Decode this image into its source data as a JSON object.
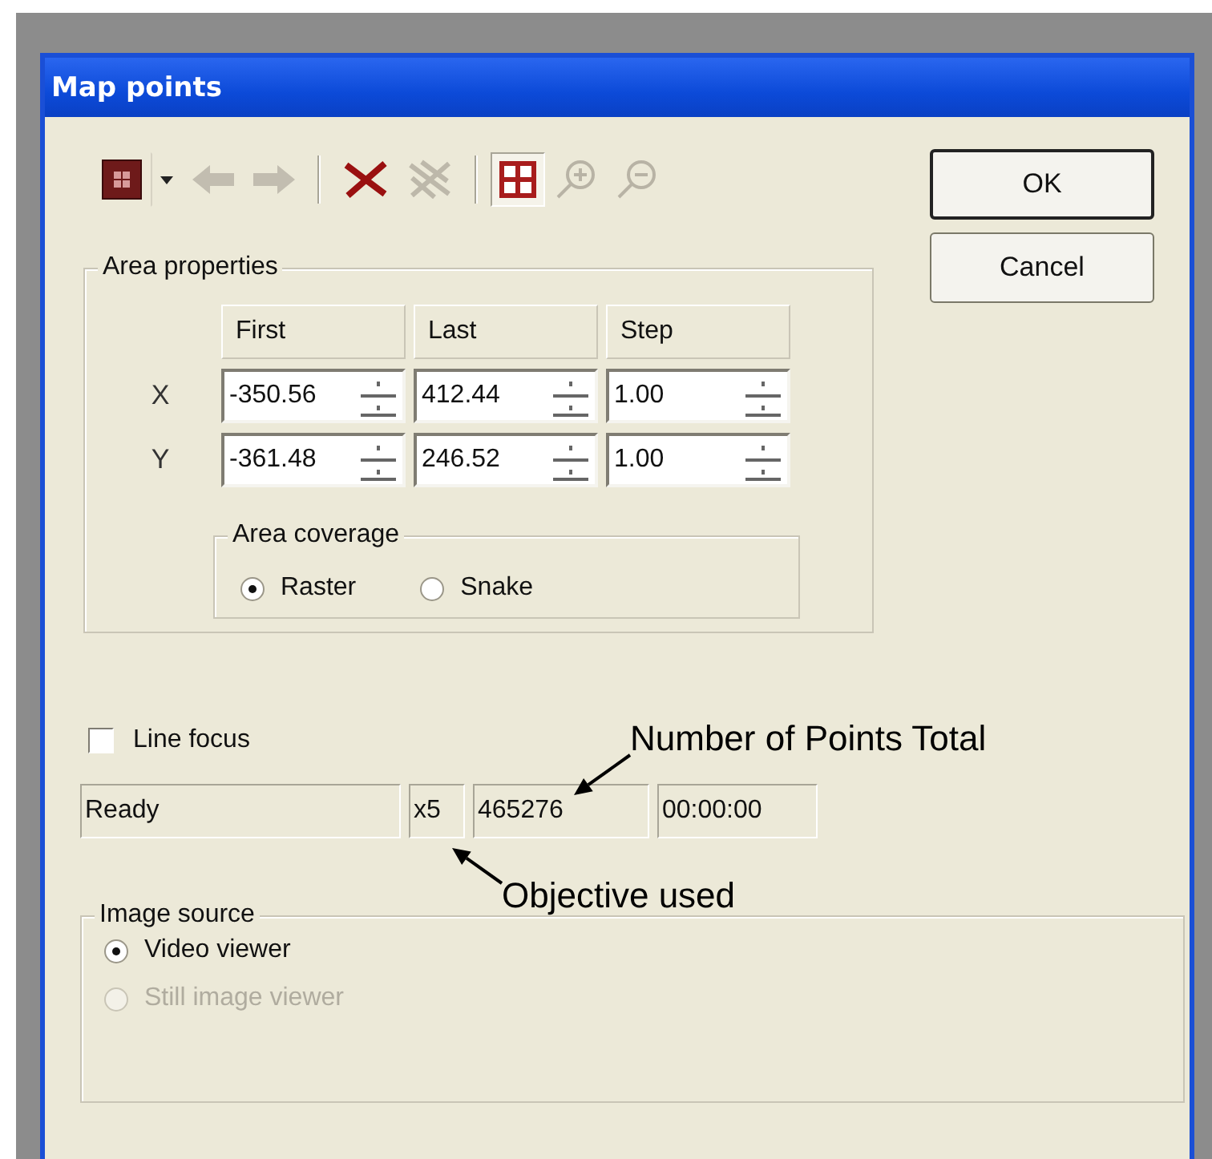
{
  "window": {
    "title": "Map points"
  },
  "toolbar": [
    [
      {
        "kind": "color",
        "disabled": false,
        "pressed": false
      },
      {
        "kind": "dropdown",
        "disabled": false,
        "pressed": false
      },
      {
        "kind": "back",
        "disabled": true,
        "pressed": false
      },
      {
        "kind": "forward",
        "disabled": true,
        "pressed": false
      }
    ],
    [
      {
        "kind": "delete",
        "disabled": false,
        "pressed": false
      },
      {
        "kind": "delete-all",
        "disabled": true,
        "pressed": false
      }
    ],
    [
      {
        "kind": "grid",
        "disabled": false,
        "pressed": true
      },
      {
        "kind": "zoom-in",
        "disabled": true,
        "pressed": false
      },
      {
        "kind": "zoom-out",
        "disabled": true,
        "pressed": false
      }
    ]
  ],
  "buttons": [
    {
      "label": "OK",
      "default": true
    },
    {
      "label": "Cancel",
      "default": false
    }
  ],
  "area_properties": {
    "title": "Area properties",
    "columns": [
      "First",
      "Last",
      "Step"
    ],
    "rows": [
      {
        "axis": "X",
        "values": [
          "-350.56",
          "412.44",
          "1.00"
        ]
      },
      {
        "axis": "Y",
        "values": [
          "-361.48",
          "246.52",
          "1.00"
        ]
      }
    ],
    "coverage": {
      "title": "Area coverage",
      "options": [
        {
          "label": "Raster",
          "selected": true
        },
        {
          "label": "Snake",
          "selected": false
        }
      ]
    }
  },
  "line_focus": {
    "label": "Line focus",
    "checked": false
  },
  "status": [
    "Ready",
    "x5",
    "465276",
    "00:00:00"
  ],
  "image_source": {
    "title": "Image source",
    "options": [
      {
        "label": "Video viewer",
        "selected": true,
        "disabled": false
      },
      {
        "label": "Still image viewer",
        "selected": false,
        "disabled": true
      }
    ]
  },
  "annotations": [
    {
      "text": "Number of Points Total"
    },
    {
      "text": "Objective used"
    }
  ]
}
